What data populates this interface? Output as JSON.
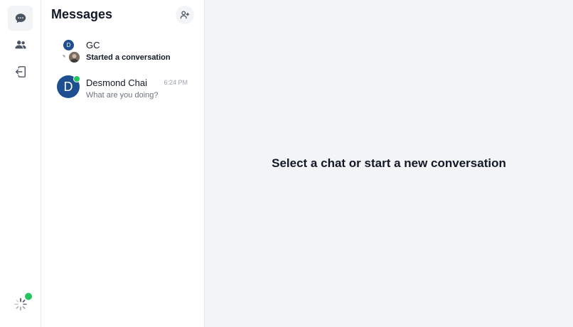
{
  "colors": {
    "accent": "#1d4f91",
    "online": "#22c55e",
    "main_bg": "#f3f4f6"
  },
  "rail": {
    "items": [
      {
        "icon": "chat-bubble-icon",
        "active": true
      },
      {
        "icon": "users-icon",
        "active": false
      },
      {
        "icon": "logout-icon",
        "active": false
      }
    ],
    "profile_icon": "loading-spinner-icon"
  },
  "sidebar": {
    "title": "Messages",
    "add_icon": "add-user-icon",
    "conversations": [
      {
        "name": "GC",
        "preview": "Started a conversation",
        "is_group": true,
        "avatar_letter": "D"
      },
      {
        "name": "Desmond Chai",
        "preview": "What are you doing?",
        "time": "6:24 PM",
        "avatar_letter": "D",
        "online": true
      }
    ]
  },
  "main": {
    "empty_text": "Select a chat or start a new conversation"
  }
}
